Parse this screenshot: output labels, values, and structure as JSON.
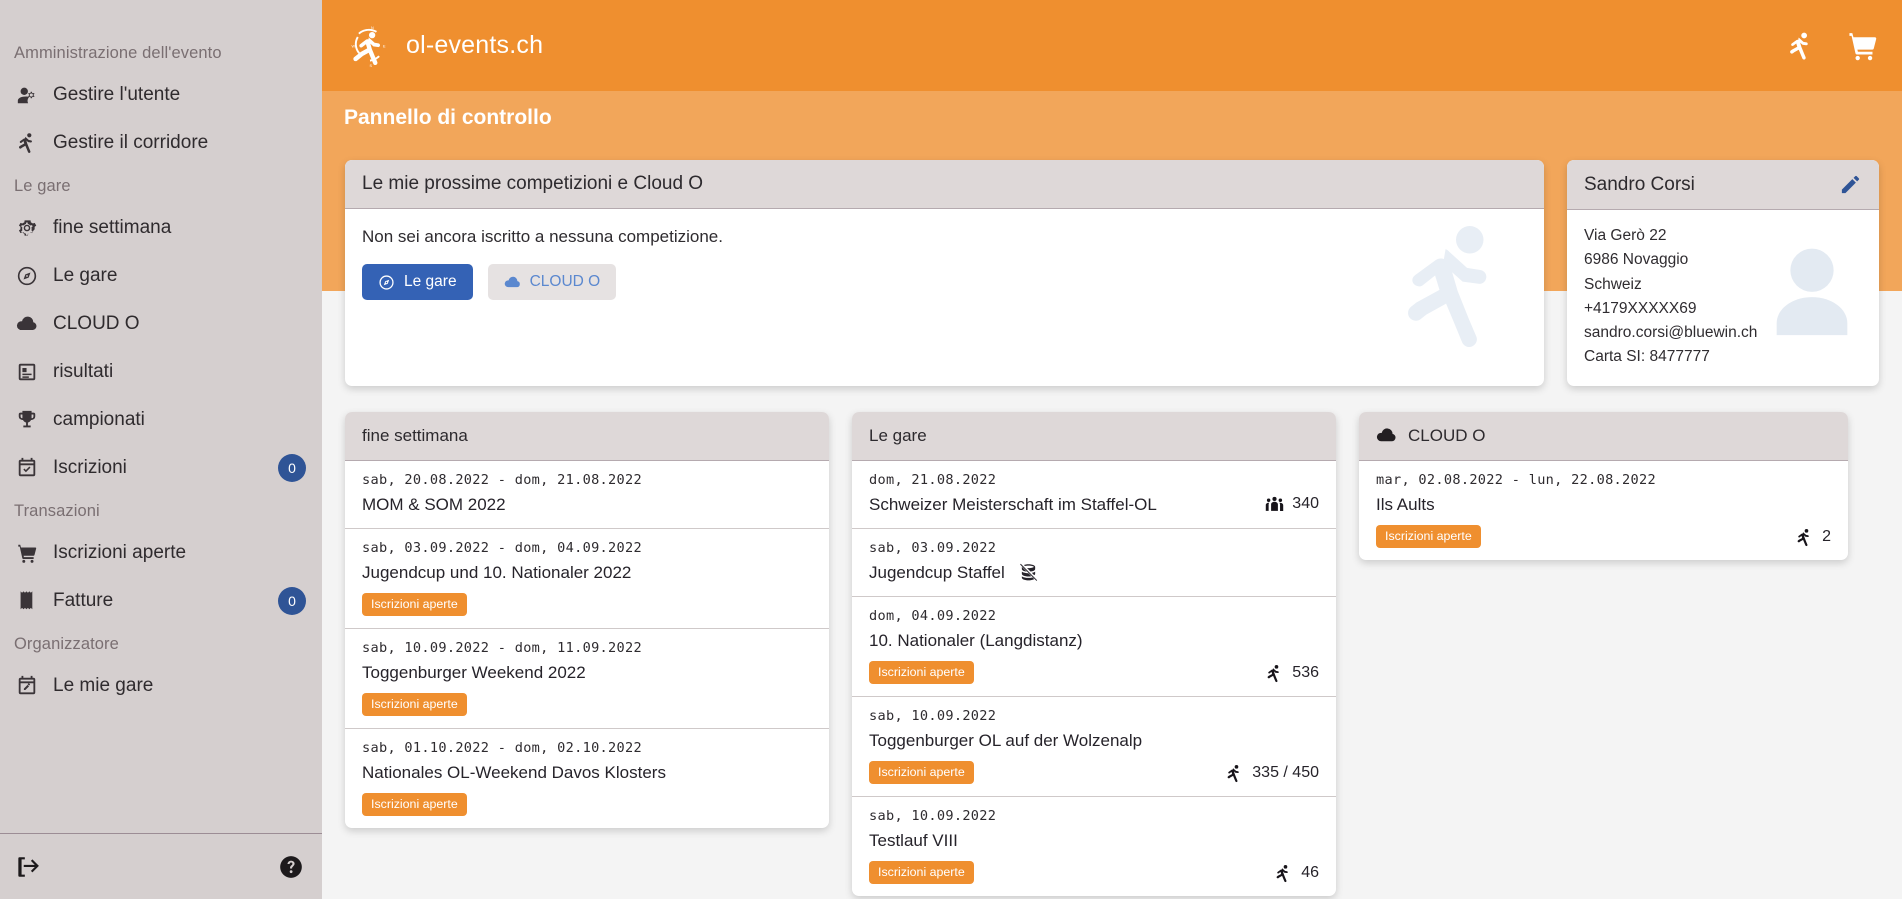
{
  "brand": {
    "name": "ol-events.ch",
    "logo_icon": "orienteering-runner-compass-icon"
  },
  "topbar": {
    "runner_icon": "runner-icon",
    "cart_icon": "shopping-cart-icon"
  },
  "subbar": {
    "title": "Pannello di controllo"
  },
  "sidebar": {
    "groups": [
      {
        "label": "Amministrazione dell'evento",
        "items": [
          {
            "label": "Gestire l'utente",
            "icon": "user-cog-icon",
            "badge": null
          },
          {
            "label": "Gestire il corridore",
            "icon": "runner-icon",
            "badge": null
          }
        ]
      },
      {
        "label": "Le gare",
        "items": [
          {
            "label": "fine settimana",
            "icon": "gear-icon",
            "badge": null
          },
          {
            "label": "Le gare",
            "icon": "compass-icon",
            "badge": null
          },
          {
            "label": "CLOUD O",
            "icon": "cloud-icon",
            "badge": null
          },
          {
            "label": "risultati",
            "icon": "list-document-icon",
            "badge": null
          },
          {
            "label": "campionati",
            "icon": "trophy-icon",
            "badge": null
          },
          {
            "label": "Iscrizioni",
            "icon": "calendar-check-icon",
            "badge": "0"
          }
        ]
      },
      {
        "label": "Transazioni",
        "items": [
          {
            "label": "Iscrizioni aperte",
            "icon": "shopping-cart-icon",
            "badge": null
          },
          {
            "label": "Fatture",
            "icon": "receipt-icon",
            "badge": "0"
          }
        ]
      },
      {
        "label": "Organizzatore",
        "items": [
          {
            "label": "Le mie gare",
            "icon": "calendar-edit-icon",
            "badge": null
          }
        ]
      }
    ],
    "footer": {
      "logout_icon": "logout-icon",
      "help_icon": "help-circle-icon"
    },
    "badge_color": "#2f5496"
  },
  "upcoming": {
    "title": "Le mie prossime competizioni e Cloud O",
    "message": "Non sei ancora iscritto a nessuna competizione.",
    "buttons": [
      {
        "label": "Le gare",
        "icon": "compass-icon",
        "style": "primary"
      },
      {
        "label": "CLOUD O",
        "icon": "cloud-icon",
        "style": "ghost"
      }
    ],
    "watermark_icon": "runner-icon"
  },
  "profile": {
    "name": "Sandro Corsi",
    "edit_icon": "pencil-icon",
    "avatar_icon": "user-avatar-placeholder-icon",
    "lines": [
      "Via Gerò 22",
      "6986 Novaggio",
      "Schweiz",
      "+4179XXXXX69",
      "sandro.corsi@bluewin.ch",
      "Carta SI: 8477777"
    ]
  },
  "columns": [
    {
      "title": "fine settimana",
      "icon": null,
      "events": [
        {
          "date": "sab, 20.08.2022 - dom, 21.08.2022",
          "title": "MOM & SOM 2022",
          "badge": null,
          "count": null,
          "count_icon": null,
          "title_icon": null
        },
        {
          "date": "sab, 03.09.2022 - dom, 04.09.2022",
          "title": "Jugendcup und 10. Nationaler 2022",
          "badge": "Iscrizioni aperte",
          "count": null,
          "count_icon": null,
          "title_icon": null
        },
        {
          "date": "sab, 10.09.2022 - dom, 11.09.2022",
          "title": "Toggenburger Weekend 2022",
          "badge": "Iscrizioni aperte",
          "count": null,
          "count_icon": null,
          "title_icon": null
        },
        {
          "date": "sab, 01.10.2022 - dom, 02.10.2022",
          "title": "Nationales OL-Weekend Davos Klosters",
          "badge": "Iscrizioni aperte",
          "count": null,
          "count_icon": null,
          "title_icon": null
        }
      ]
    },
    {
      "title": "Le gare",
      "icon": null,
      "events": [
        {
          "date": "dom, 21.08.2022",
          "title": "Schweizer Meisterschaft im Staffel-OL",
          "badge": null,
          "count": "340",
          "count_icon": "group-people-icon",
          "count_position": "top",
          "title_icon": null
        },
        {
          "date": "sab, 03.09.2022",
          "title": "Jugendcup Staffel",
          "badge": null,
          "count": null,
          "count_icon": null,
          "title_icon": "database-off-icon"
        },
        {
          "date": "dom, 04.09.2022",
          "title": "10. Nationaler (Langdistanz)",
          "badge": "Iscrizioni aperte",
          "count": "536",
          "count_icon": "runner-icon",
          "title_icon": null
        },
        {
          "date": "sab, 10.09.2022",
          "title": "Toggenburger OL auf der Wolzenalp",
          "badge": "Iscrizioni aperte",
          "count": "335 / 450",
          "count_icon": "runner-icon",
          "title_icon": null
        },
        {
          "date": "sab, 10.09.2022",
          "title": "Testlauf VIII",
          "badge": "Iscrizioni aperte",
          "count": "46",
          "count_icon": "runner-icon",
          "title_icon": null
        }
      ]
    },
    {
      "title": "CLOUD O",
      "icon": "cloud-icon",
      "events": [
        {
          "date": "mar, 02.08.2022 - lun, 22.08.2022",
          "title": "Ils Aults",
          "badge": "Iscrizioni aperte",
          "count": "2",
          "count_icon": "runner-icon",
          "title_icon": null
        }
      ]
    }
  ],
  "colors": {
    "brand_orange": "#ef8f2f",
    "subbar_orange": "#f2a65a",
    "sidebar_bg": "#d5cfcf",
    "badge_blue": "#2f5496",
    "primary_blue": "#3462b5"
  }
}
